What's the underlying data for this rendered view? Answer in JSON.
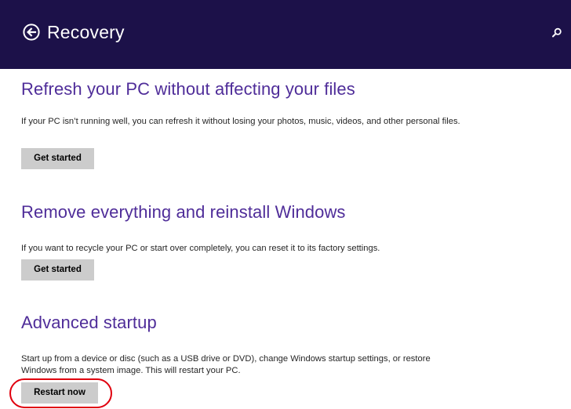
{
  "header": {
    "title": "Recovery",
    "back_icon": "back-arrow-circle-icon",
    "search_icon": "search-icon",
    "background_color": "#1c1149"
  },
  "sections": [
    {
      "heading": "Refresh your PC without affecting your files",
      "description": "If your PC isn’t running well, you can refresh it without losing your photos, music, videos, and other personal files.",
      "button_label": "Get started"
    },
    {
      "heading": "Remove everything and reinstall Windows",
      "description": "If you want to recycle your PC or start over completely, you can reset it to its factory settings.",
      "button_label": "Get started"
    },
    {
      "heading": "Advanced startup",
      "description": "Start up from a device or disc (such as a USB drive or DVD), change Windows startup settings, or restore Windows from a system image. This will restart your PC.",
      "button_label": "Restart now"
    }
  ],
  "colors": {
    "heading": "#4f2d99",
    "button_bg": "#cccccc",
    "highlight": "#e0000e"
  }
}
